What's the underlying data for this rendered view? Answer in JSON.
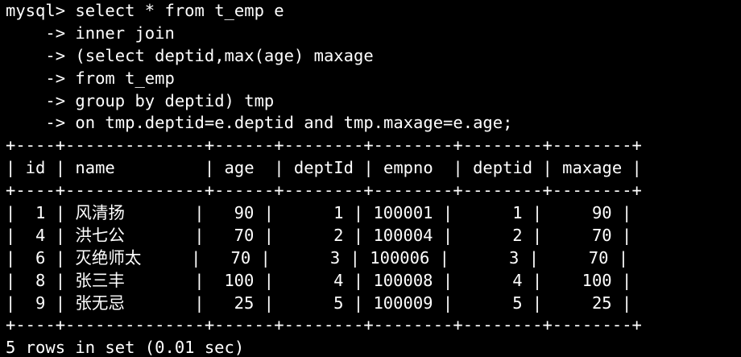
{
  "terminal": {
    "prompt": "mysql> ",
    "continuation_prompt": "    -> ",
    "query_lines": [
      "select * from t_emp e",
      "inner join",
      "(select deptid,max(age) maxage",
      "from t_emp",
      "group by deptid) tmp",
      "on tmp.deptid=e.deptid and tmp.maxage=e.age;"
    ],
    "table": {
      "border": "+----+--------------+------+--------+--------+--------+--------+",
      "header": "| id | name         | age  | deptId | empno  | deptid | maxage |",
      "columns": [
        "id",
        "name",
        "age",
        "deptId",
        "empno",
        "deptid",
        "maxage"
      ],
      "rows": [
        {
          "id": "1",
          "name": "风清扬",
          "age": "90",
          "deptId": "1",
          "empno": "100001",
          "deptid": "1",
          "maxage": "90",
          "text": "|  1 | 风清扬       |   90 |      1 | 100001 |      1 |     90 |"
        },
        {
          "id": "4",
          "name": "洪七公",
          "age": "70",
          "deptId": "2",
          "empno": "100004",
          "deptid": "2",
          "maxage": "70",
          "text": "|  4 | 洪七公       |   70 |      2 | 100004 |      2 |     70 |"
        },
        {
          "id": "6",
          "name": "灭绝师太",
          "age": "70",
          "deptId": "3",
          "empno": "100006",
          "deptid": "3",
          "maxage": "70",
          "text": "|  6 | 灭绝师太     |   70 |      3 | 100006 |      3 |     70 |"
        },
        {
          "id": "8",
          "name": "张三丰",
          "age": "100",
          "deptId": "4",
          "empno": "100008",
          "deptid": "4",
          "maxage": "100",
          "text": "|  8 | 张三丰       |  100 |      4 | 100008 |      4 |    100 |"
        },
        {
          "id": "9",
          "name": "张无忌",
          "age": "25",
          "deptId": "5",
          "empno": "100009",
          "deptid": "5",
          "maxage": "25",
          "text": "|  9 | 张无忌       |   25 |      5 | 100009 |      5 |     25 |"
        }
      ]
    },
    "result_summary": "5 rows in set (0.01 sec)",
    "colors": {
      "background": "#000000",
      "foreground": "#ffffff"
    }
  }
}
